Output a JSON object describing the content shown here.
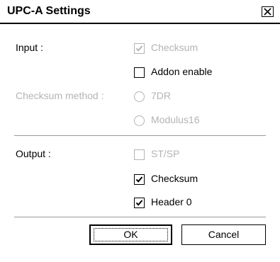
{
  "window": {
    "title": "UPC-A Settings"
  },
  "input_section": {
    "label": "Input :",
    "checksum": {
      "label": "Checksum",
      "checked": true,
      "enabled": false
    },
    "addon": {
      "label": "Addon enable",
      "checked": false,
      "enabled": true
    }
  },
  "checksum_method": {
    "label": "Checksum method :",
    "options": [
      {
        "label": "7DR",
        "selected": false,
        "enabled": false
      },
      {
        "label": "Modulus16",
        "selected": false,
        "enabled": false
      }
    ]
  },
  "output_section": {
    "label": "Output :",
    "stsp": {
      "label": "ST/SP",
      "checked": false,
      "enabled": false
    },
    "checksum": {
      "label": "Checksum",
      "checked": true,
      "enabled": true
    },
    "header0": {
      "label": "Header 0",
      "checked": true,
      "enabled": true
    }
  },
  "buttons": {
    "ok": "OK",
    "cancel": "Cancel"
  },
  "colors": {
    "disabled_text": "#b4b4b4",
    "separator": "#9a9a9a"
  }
}
